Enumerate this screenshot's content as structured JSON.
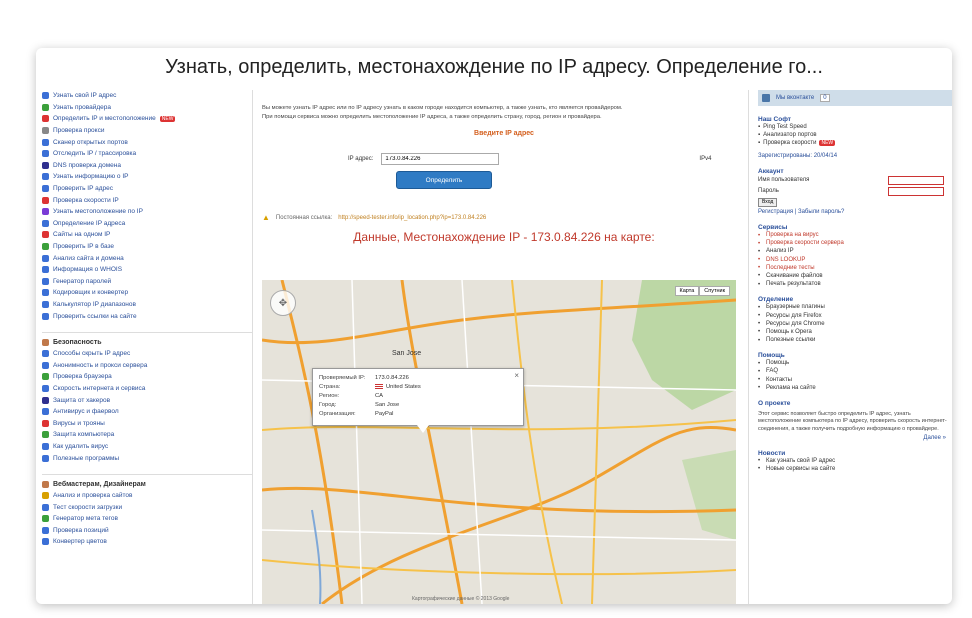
{
  "page_title": "Узнать, определить, местонахождение по IP адресу. Определение го...",
  "left_menu": [
    {
      "label": "Узнать свой IP адрес",
      "color": "#3b6fd6"
    },
    {
      "label": "Узнать провайдера",
      "color": "#3ba03b"
    },
    {
      "label": "Определить IP и местоположение",
      "color": "#d33",
      "badge": "NEW"
    },
    {
      "label": "Проверка прокси",
      "color": "#888"
    },
    {
      "label": "Сканер открытых портов",
      "color": "#3b6fd6"
    },
    {
      "label": "Отследить IP / трассировка",
      "color": "#3b6fd6"
    },
    {
      "label": "DNS проверка домена",
      "color": "#2f2f8f"
    },
    {
      "label": "Узнать информацию о IP",
      "color": "#3b6fd6"
    },
    {
      "label": "Проверить IP адрес",
      "color": "#3b6fd6"
    },
    {
      "label": "Проверка скорости IP",
      "color": "#d33"
    },
    {
      "label": "Узнать местоположение по IP",
      "color": "#7a3bd6"
    },
    {
      "label": "Определение IP адреса",
      "color": "#3b6fd6"
    },
    {
      "label": "Сайты на одном IP",
      "color": "#d33"
    },
    {
      "label": "Проверить IP в базе",
      "color": "#3ba03b"
    },
    {
      "label": "Анализ сайта и домена",
      "color": "#3b6fd6"
    },
    {
      "label": "Информация о WHOIS",
      "color": "#3b6fd6"
    },
    {
      "label": "Генератор паролей",
      "color": "#3b6fd6"
    },
    {
      "label": "Кодировщик и конвертер",
      "color": "#3b6fd6"
    },
    {
      "label": "Калькулятор IP диапазонов",
      "color": "#3b6fd6"
    },
    {
      "label": "Проверить ссылки на сайте",
      "color": "#3b6fd6"
    }
  ],
  "section_2": {
    "title": "Безопасность",
    "items": [
      {
        "label": "Способы скрыть IP адрес",
        "color": "#3b6fd6"
      },
      {
        "label": "Анонимность и прокси сервера",
        "color": "#3b6fd6"
      },
      {
        "label": "Проверка браузера",
        "color": "#3ba03b"
      },
      {
        "label": "Скорость интернета и сервиса",
        "color": "#3b6fd6"
      },
      {
        "label": "Защита от хакеров",
        "color": "#2f2f8f"
      },
      {
        "label": "Антивирус и фаервол",
        "color": "#3b6fd6"
      },
      {
        "label": "Вирусы и трояны",
        "color": "#d33"
      },
      {
        "label": "Защита компьютера",
        "color": "#3ba03b"
      },
      {
        "label": "Как удалить вирус",
        "color": "#3b6fd6"
      },
      {
        "label": "Полезные программы",
        "color": "#3b6fd6"
      }
    ]
  },
  "section_3": {
    "title": "Вебмастерам, Дизайнерам",
    "items": [
      {
        "label": "Анализ и проверка сайтов",
        "color": "#d8a000"
      },
      {
        "label": "Тест скорости загрузки",
        "color": "#3b6fd6"
      },
      {
        "label": "Генератор мета тегов",
        "color": "#3ba03b"
      },
      {
        "label": "Проверка позиций",
        "color": "#3b6fd6"
      },
      {
        "label": "Конвертер цветов",
        "color": "#3b6fd6"
      }
    ]
  },
  "main": {
    "intro_1": "Вы можете узнать IP адрес или по IP адресу узнать в каком городе находится компьютер, а также узнать, кто является провайдером.",
    "intro_2": "При помощи сервиса можно определить местоположение IP адреса, а также определить страну, город, регион и провайдера.",
    "enter_label": "Введите IP адрес",
    "ip_label": "IP адрес:",
    "ip_value": "173.0.84.226",
    "version_label": "IPv4",
    "submit_label": "Определить",
    "shortlink_label": "Постоянная ссылка:",
    "shortlink_url": "http://speed-tester.info/ip_location.php?ip=173.0.84.226",
    "map_heading": "Данные, Местонахождение IP - 173.0.84.226 на карте:"
  },
  "map": {
    "type_buttons": [
      "Карта",
      "Спутник"
    ],
    "popup": {
      "rows": [
        {
          "k": "Проверяемый IP:",
          "v": "173.0.84.226"
        },
        {
          "k": "Страна:",
          "v": "United States"
        },
        {
          "k": "Регион:",
          "v": "CA"
        },
        {
          "k": "Город:",
          "v": "San Jose"
        },
        {
          "k": "Организация:",
          "v": "PayPal"
        }
      ]
    },
    "labels": [
      "San Jose"
    ],
    "footer": "Картографические данные © 2013 Google"
  },
  "right": {
    "top_label": "Мы вконтакте",
    "top_count": "0",
    "soft_title": "Наш Софт",
    "soft_items": [
      "Ping Test Speed",
      "Анализатор портов",
      "Проверка скорости"
    ],
    "soft_new": "NEW",
    "registered": "Зарегистрированы: 20/04/14",
    "account_title": "Аккаунт",
    "login_label": "Имя пользователя",
    "password_label": "Пароль",
    "login_btn": "Вход",
    "register_links": "Регистрация | Забыли пароль?",
    "services_title": "Сервисы",
    "services": [
      {
        "label": "Проверка на вирус",
        "red": true
      },
      {
        "label": "Проверка скорости сервера",
        "red": true
      },
      {
        "label": "Анализ IP",
        "red": false
      },
      {
        "label": "DNS LOOKUP",
        "red": true
      },
      {
        "label": "Последние тесты",
        "red": true
      },
      {
        "label": "Скачивание файлов",
        "red": false
      },
      {
        "label": "Печать результатов",
        "red": false
      }
    ],
    "partners_title": "Отделение",
    "partners": [
      "Браузерные плагины",
      "Ресурсы для Firefox",
      "Ресурсы для Chrome",
      "Помощь к Opera",
      "Полезные ссылки"
    ],
    "help_title": "Помощь",
    "help_items": [
      "Помощь",
      "FAQ",
      "Контакты",
      "Реклама на сайте"
    ],
    "about_title": "О проекте",
    "about_text": "Этот сервис позволяет быстро определить IP адрес, узнать местоположение компьютера по IP адресу, проверить скорость интернет-соединения, а также получить подробную информацию о провайдере.",
    "more_link": "Далее »",
    "news_title": "Новости",
    "news_items": [
      "Как узнать свой IP адрес",
      "Новые сервисы на сайте"
    ]
  }
}
